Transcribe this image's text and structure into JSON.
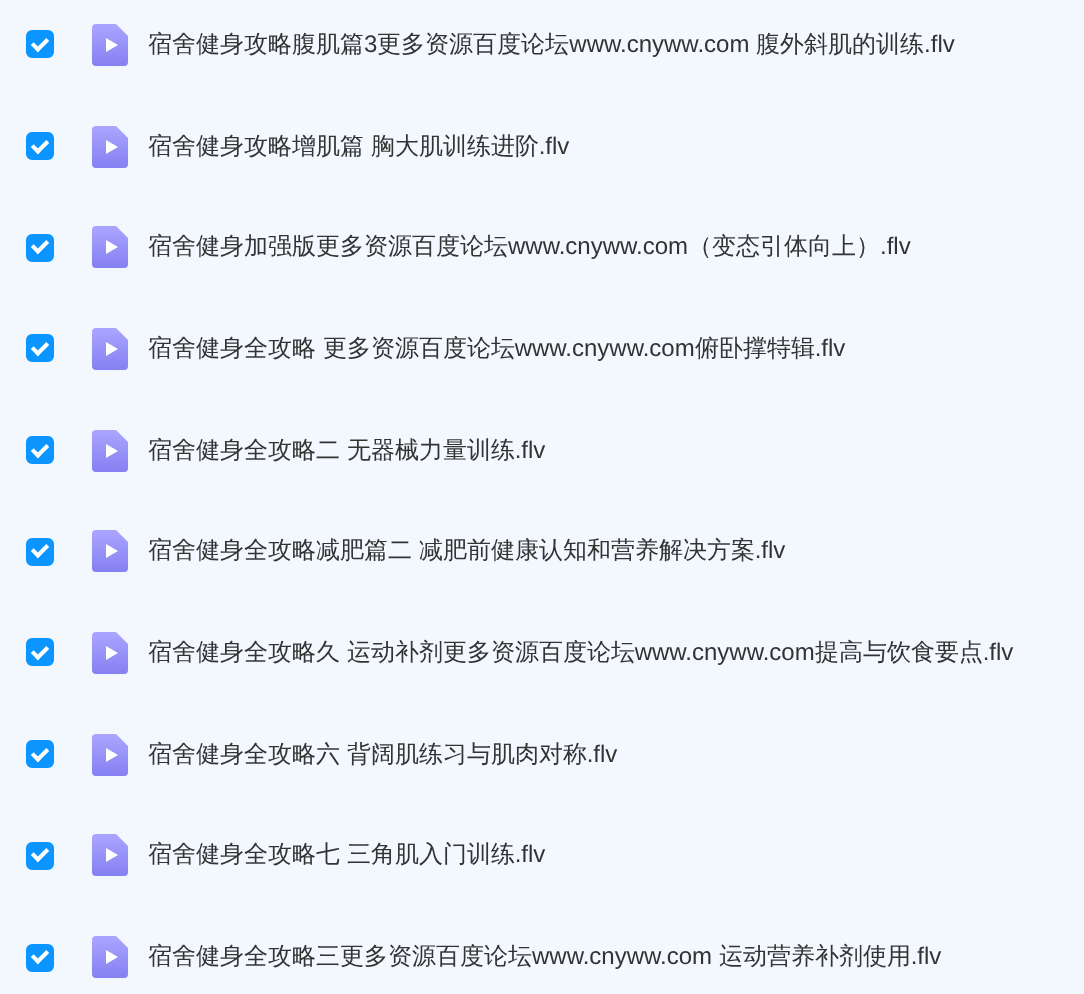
{
  "files": [
    {
      "name": "宿舍健身攻略腹肌篇3更多资源百度论坛www.cnyww.com 腹外斜肌的训练.flv",
      "checked": true
    },
    {
      "name": "宿舍健身攻略增肌篇 胸大肌训练进阶.flv",
      "checked": true
    },
    {
      "name": "宿舍健身加强版更多资源百度论坛www.cnyww.com（变态引体向上）.flv",
      "checked": true
    },
    {
      "name": "宿舍健身全攻略 更多资源百度论坛www.cnyww.com俯卧撑特辑.flv",
      "checked": true
    },
    {
      "name": "宿舍健身全攻略二 无器械力量训练.flv",
      "checked": true
    },
    {
      "name": "宿舍健身全攻略减肥篇二 减肥前健康认知和营养解决方案.flv",
      "checked": true
    },
    {
      "name": "宿舍健身全攻略久 运动补剂更多资源百度论坛www.cnyww.com提高与饮食要点.flv",
      "checked": true
    },
    {
      "name": "宿舍健身全攻略六 背阔肌练习与肌肉对称.flv",
      "checked": true
    },
    {
      "name": "宿舍健身全攻略七 三角肌入门训练.flv",
      "checked": true
    },
    {
      "name": "宿舍健身全攻略三更多资源百度论坛www.cnyww.com 运动营养补剂使用.flv",
      "checked": true
    }
  ]
}
